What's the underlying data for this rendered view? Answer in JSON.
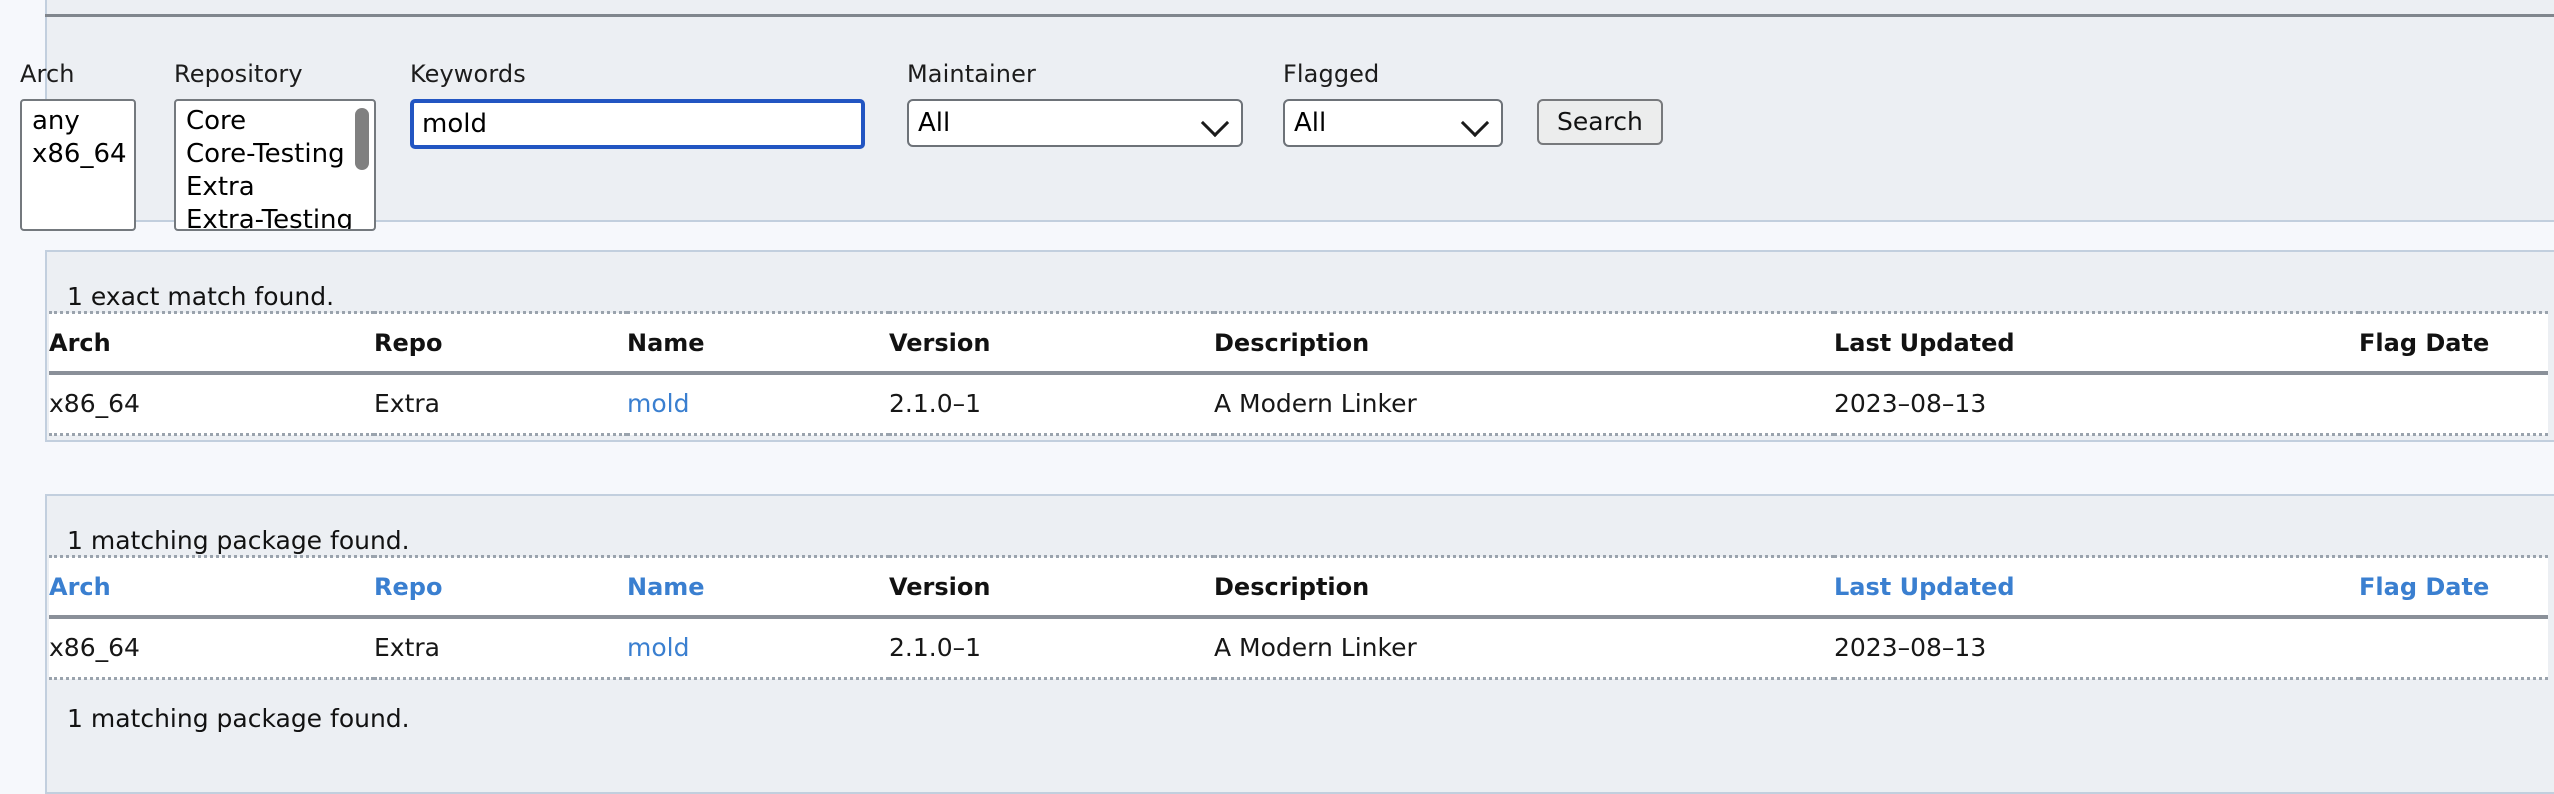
{
  "search_form": {
    "arch": {
      "label": "Arch",
      "options": [
        "any",
        "x86_64"
      ],
      "selected": ""
    },
    "repository": {
      "label": "Repository",
      "options": [
        "Core",
        "Core-Testing",
        "Extra",
        "Extra-Testing"
      ],
      "selected": ""
    },
    "keywords": {
      "label": "Keywords",
      "value": "mold",
      "placeholder": ""
    },
    "maintainer": {
      "label": "Maintainer",
      "selected": "All",
      "options": [
        "All"
      ]
    },
    "flagged": {
      "label": "Flagged",
      "selected": "All",
      "options": [
        "All"
      ]
    },
    "search_button_label": "Search"
  },
  "exact_results": {
    "summary": "1 exact match found.",
    "columns": [
      "Arch",
      "Repo",
      "Name",
      "Version",
      "Description",
      "Last Updated",
      "Flag Date"
    ],
    "column_is_link": [
      false,
      false,
      false,
      false,
      false,
      false,
      false
    ],
    "rows": [
      {
        "arch": "x86_64",
        "repo": "Extra",
        "name": "mold",
        "version": "2.1.0–1",
        "description": "A Modern Linker",
        "last_updated": "2023–08–13",
        "flag_date": ""
      }
    ]
  },
  "matching_results": {
    "summary": "1 matching package found.",
    "columns": [
      "Arch",
      "Repo",
      "Name",
      "Version",
      "Description",
      "Last Updated",
      "Flag Date"
    ],
    "column_is_link": [
      true,
      true,
      true,
      false,
      false,
      true,
      true
    ],
    "rows": [
      {
        "arch": "x86_64",
        "repo": "Extra",
        "name": "mold",
        "version": "2.1.0–1",
        "description": "A Modern Linker",
        "last_updated": "2023–08–13",
        "flag_date": ""
      }
    ],
    "footer": "1 matching package found."
  },
  "colors": {
    "link": "#3a7fd0",
    "panel_bg": "#eceff3",
    "panel_border": "#c2cfde",
    "page_bg": "#f6f8fc",
    "focus_ring": "#2255c2"
  }
}
